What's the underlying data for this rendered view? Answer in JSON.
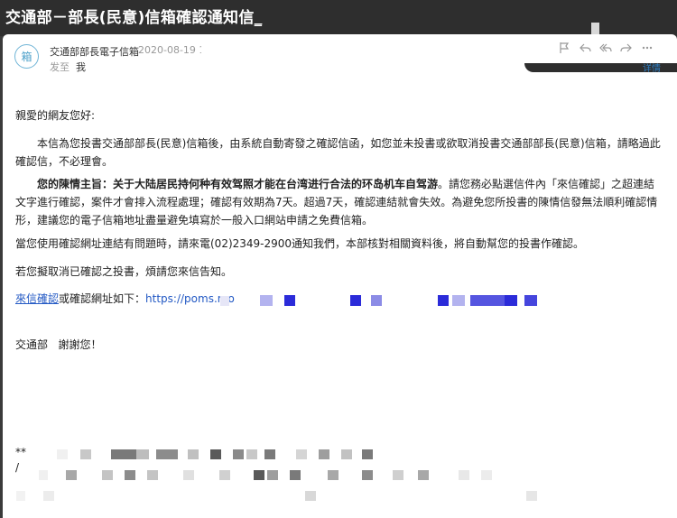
{
  "window": {
    "title": "交通部－部長(民意)信箱確認通知信"
  },
  "header": {
    "avatar_char": "箱",
    "sender": "交通部部長電子信箱",
    "date": "2020-08-19 1",
    "sent_label": "发至",
    "sent_to": "我",
    "details_label": "详情"
  },
  "toolbar": {
    "icons": [
      "flag-icon",
      "reply-icon",
      "reply-all-icon",
      "forward-icon",
      "more-icon"
    ]
  },
  "body": {
    "greeting": "親愛的網友您好:",
    "para1": "本信為您投書交通部部長(民意)信箱後，由系統自動寄發之確認信函，如您並未投書或欲取消投書交通部部長(民意)信箱，請略過此確認信，不必理會。",
    "para2_subject_label": "您的陳情主旨：",
    "para2_subject": "关于大陆居民持何种有效驾照才能在台湾进行合法的环岛机车自驾游",
    "para2_rest": "。請您務必點選信件內「來信確認」之超連結文字進行確認，案件才會排入流程處理；確認有效期為7天。超過7天，確認連結就會失效。為避免您所投書的陳情信發無法順利確認情形，建議您的電子信箱地址盡量避免填寫於一般入口網站申請之免費信箱。",
    "para3": "當您使用確認網址連結有問題時，請來電(02)2349-2900通知我們，本部核對相關資料後，將自動幫您的投書作確認。",
    "para4": "若您擬取消已確認之投書，煩請您來信告知。",
    "confirm_link": "來信確認",
    "confirm_text": "或確認網址如下：",
    "confirm_url": "https://poms.mo",
    "signoff_org": "交通部",
    "signoff_thanks": "謝謝您！",
    "footer_marker1": "**",
    "footer_marker2": "/"
  },
  "colors": {
    "link": "#2359c4",
    "accent": "#2f7fc4",
    "redact_blue": "#2b2bd9"
  }
}
